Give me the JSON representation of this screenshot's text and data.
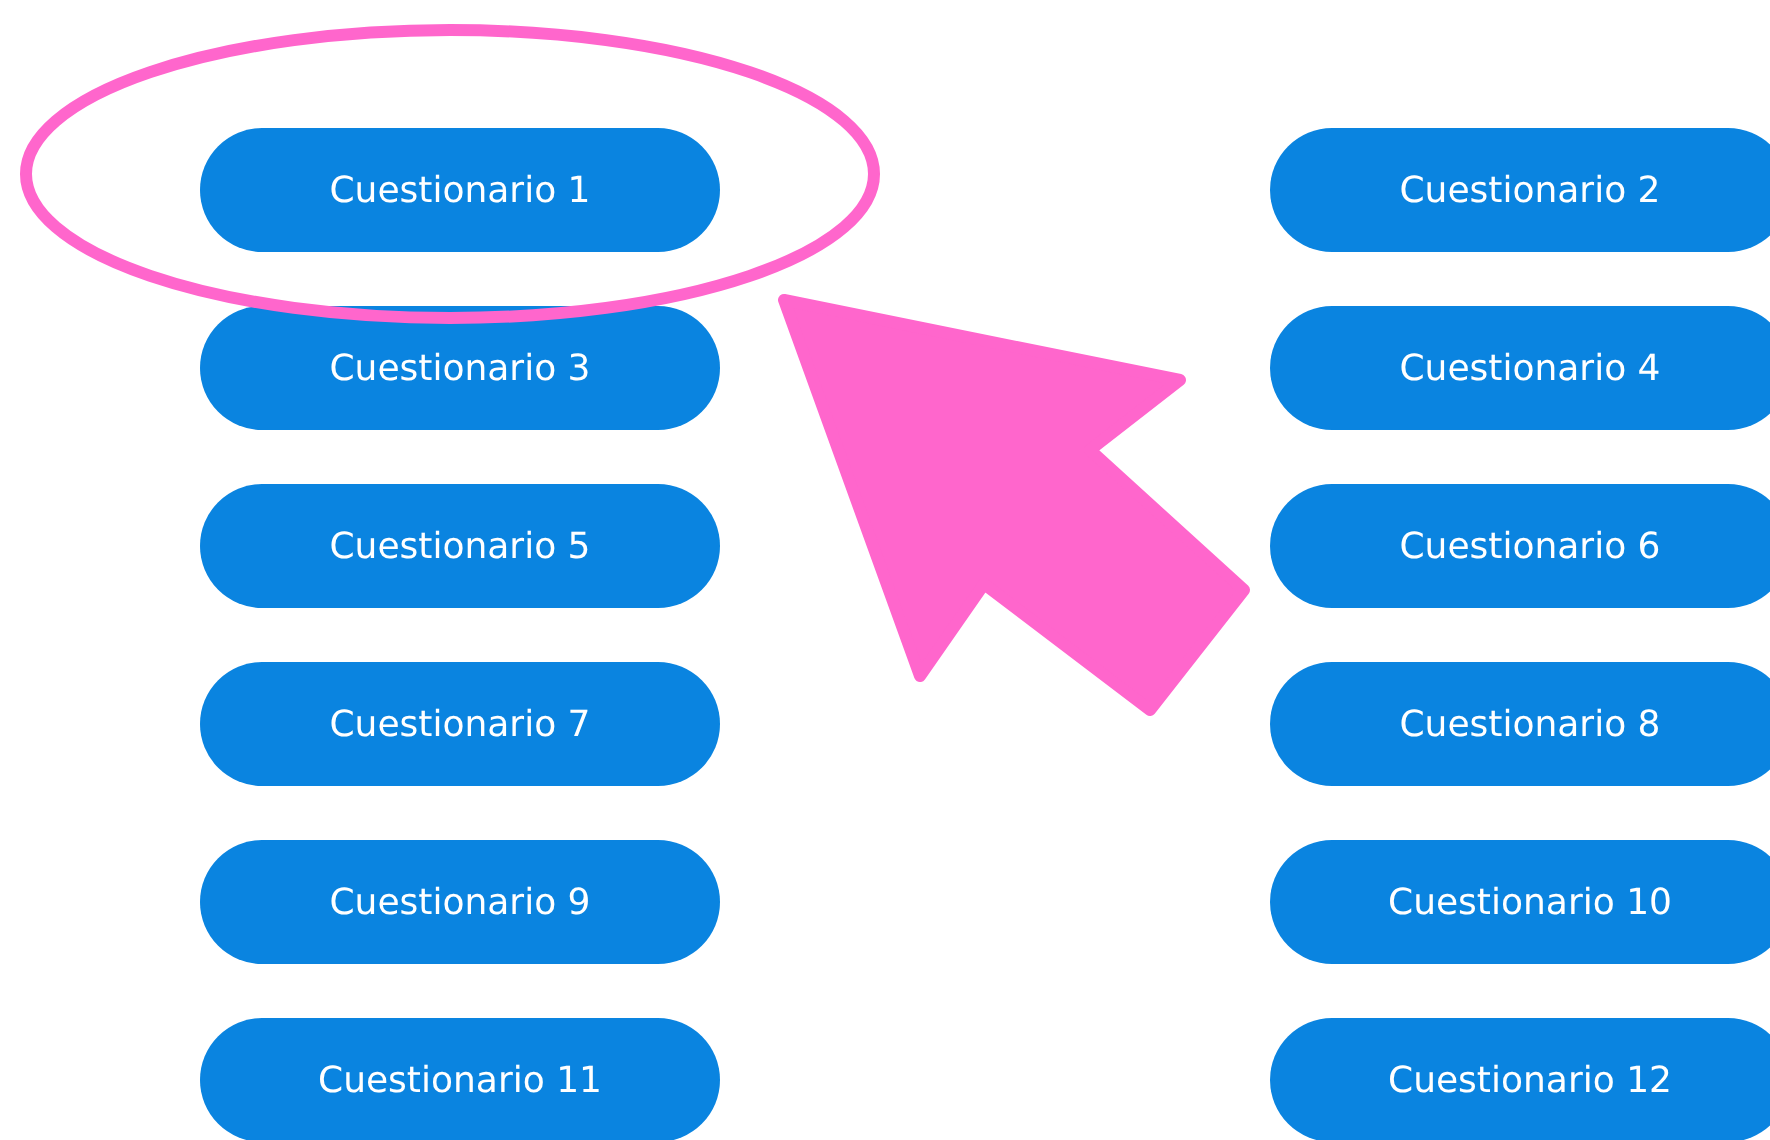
{
  "buttons": [
    {
      "label": "Cuestionario 1"
    },
    {
      "label": "Cuestionario 2"
    },
    {
      "label": "Cuestionario 3"
    },
    {
      "label": "Cuestionario 4"
    },
    {
      "label": "Cuestionario 5"
    },
    {
      "label": "Cuestionario 6"
    },
    {
      "label": "Cuestionario 7"
    },
    {
      "label": "Cuestionario 8"
    },
    {
      "label": "Cuestionario 9"
    },
    {
      "label": "Cuestionario 10"
    },
    {
      "label": "Cuestionario 11"
    },
    {
      "label": "Cuestionario 12"
    }
  ]
}
